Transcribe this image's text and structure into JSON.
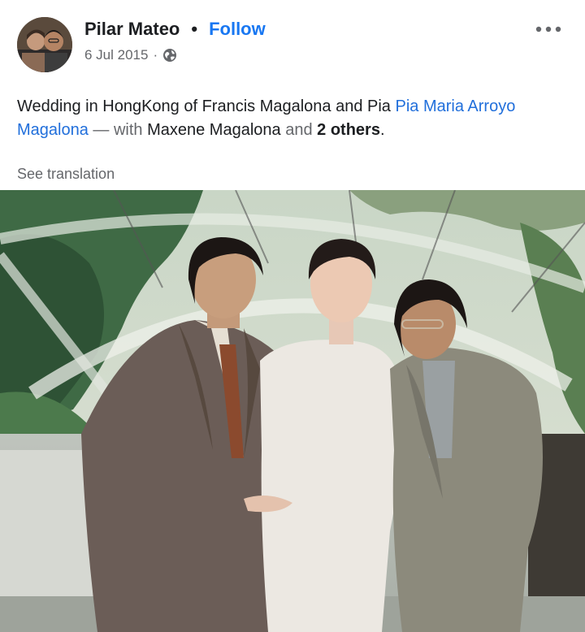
{
  "post": {
    "author": "Pilar Mateo",
    "separator": "•",
    "follow_label": "Follow",
    "date": "6 Jul 2015",
    "meta_separator": "·",
    "privacy_icon": "globe-icon",
    "more_icon": "more-options-icon"
  },
  "caption": {
    "text_1": "Wedding in HongKong of Francis Magalona and Pia ",
    "tag_1": "Pia Maria Arroyo Magalona",
    "with_text": " — with ",
    "tag_2": "Maxene Magalona",
    "and_text": " and ",
    "others": "2 others",
    "end": "."
  },
  "translation_label": "See translation",
  "colors": {
    "link": "#216fdb",
    "follow": "#1877f2",
    "muted": "#65676b"
  }
}
